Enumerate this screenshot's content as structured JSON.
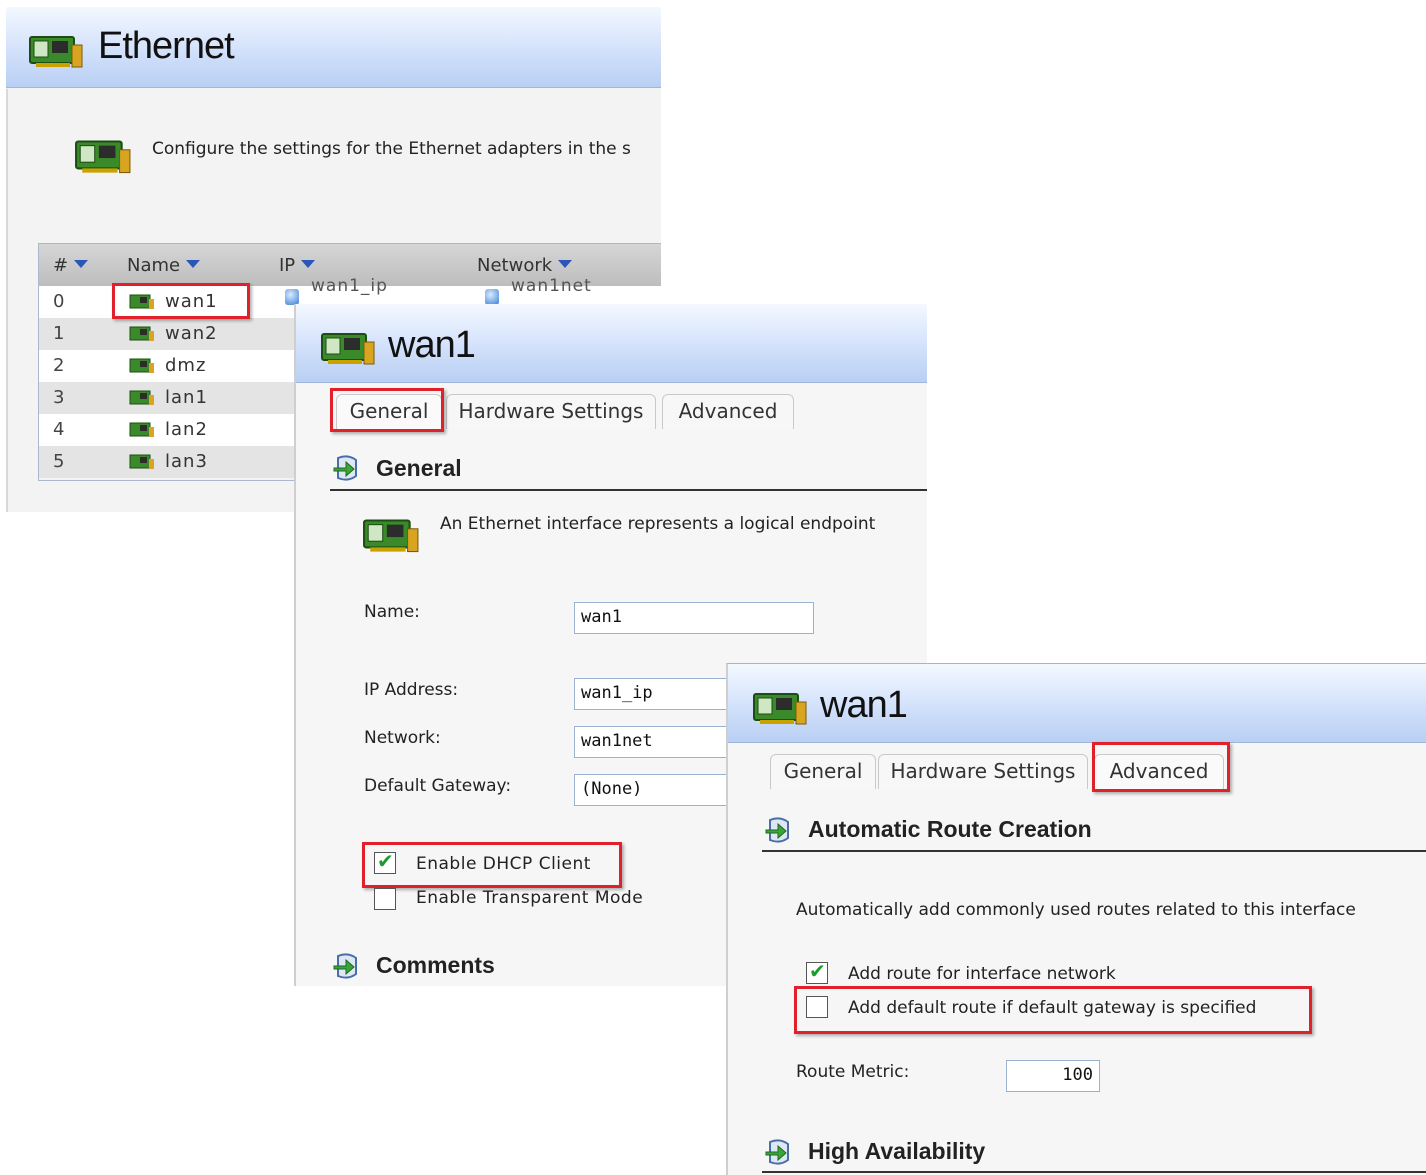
{
  "ethernet_panel": {
    "title": "Ethernet",
    "description": "Configure the settings for the Ethernet adapters in the s",
    "columns": [
      {
        "label": "#"
      },
      {
        "label": "Name"
      },
      {
        "label": "IP"
      },
      {
        "label": "Network"
      }
    ],
    "rows": [
      {
        "num": "0",
        "name": "wan1"
      },
      {
        "num": "1",
        "name": "wan2"
      },
      {
        "num": "2",
        "name": "dmz"
      },
      {
        "num": "3",
        "name": "lan1"
      },
      {
        "num": "4",
        "name": "lan2"
      },
      {
        "num": "5",
        "name": "lan3"
      }
    ],
    "first_row_ip": "wan1_ip",
    "first_row_network": "wan1net"
  },
  "general_panel": {
    "title": "wan1",
    "tabs": [
      {
        "label": "General",
        "active": true
      },
      {
        "label": "Hardware Settings",
        "active": false
      },
      {
        "label": "Advanced",
        "active": false
      }
    ],
    "section_general": "General",
    "description": "An Ethernet interface represents a logical endpoint",
    "name_label": "Name:",
    "name_value": "wan1",
    "ip_label": "IP Address:",
    "ip_value": "wan1_ip",
    "network_label": "Network:",
    "network_value": "wan1net",
    "gateway_label": "Default Gateway:",
    "gateway_value": "(None)",
    "dhcp_label": "Enable DHCP Client",
    "dhcp_checked": true,
    "transparent_label": "Enable Transparent Mode",
    "transparent_checked": false,
    "section_comments": "Comments"
  },
  "advanced_panel": {
    "title": "wan1",
    "tabs": [
      {
        "label": "General",
        "active": false
      },
      {
        "label": "Hardware Settings",
        "active": false
      },
      {
        "label": "Advanced",
        "active": true
      }
    ],
    "section_route": "Automatic Route Creation",
    "route_description": "Automatically add commonly used routes related to this interface",
    "add_route_label": "Add route for interface network",
    "add_route_checked": true,
    "default_route_label": "Add default route if default gateway is specified",
    "default_route_checked": false,
    "metric_label": "Route Metric:",
    "metric_value": "100",
    "section_ha": "High Availability"
  },
  "colors": {
    "highlight": "#e0202a",
    "header_gradient_bottom": "#b9cff3",
    "checkmark": "#1d9a2d"
  }
}
